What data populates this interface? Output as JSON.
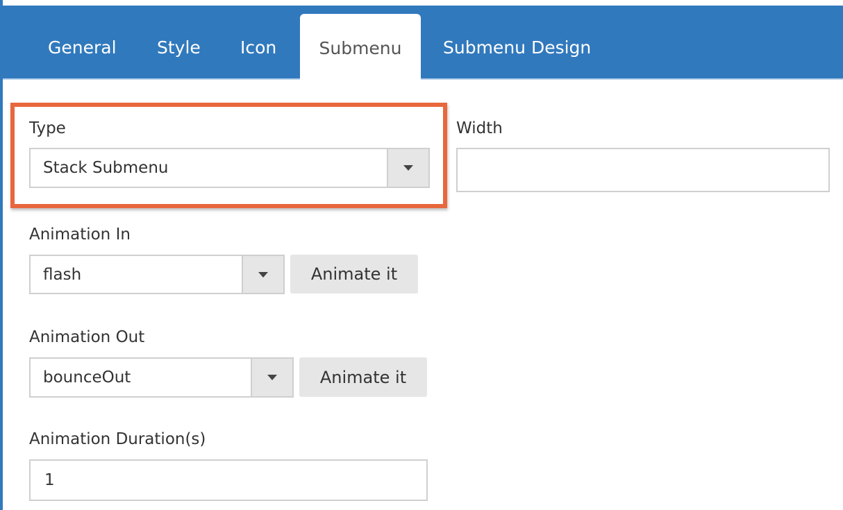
{
  "colors": {
    "tabbar": "#3179bd",
    "highlight": "#e8673c",
    "button_bg": "#e6e6e6"
  },
  "tabs": [
    {
      "label": "General",
      "active": false
    },
    {
      "label": "Style",
      "active": false
    },
    {
      "label": "Icon",
      "active": false
    },
    {
      "label": "Submenu",
      "active": true
    },
    {
      "label": "Submenu Design",
      "active": false
    }
  ],
  "form": {
    "type": {
      "label": "Type",
      "value": "Stack Submenu"
    },
    "width": {
      "label": "Width",
      "value": ""
    },
    "animation_in": {
      "label": "Animation In",
      "value": "flash",
      "button": "Animate it"
    },
    "animation_out": {
      "label": "Animation Out",
      "value": "bounceOut",
      "button": "Animate it"
    },
    "animation_duration": {
      "label": "Animation Duration(s)",
      "value": "1"
    }
  },
  "icons": {
    "dropdown": "caret-down-icon"
  }
}
